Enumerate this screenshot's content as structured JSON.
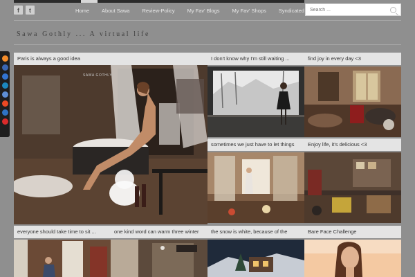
{
  "nav": {
    "items": [
      "Home",
      "About Sawa",
      "Review-Policy",
      "My Fav' Blogs",
      "My Fav' Shops",
      "Syndicated with"
    ]
  },
  "social": {
    "facebook_glyph": "f",
    "twitter_glyph": "t"
  },
  "search": {
    "placeholder": "Search ..."
  },
  "site": {
    "title": "Sawa Gothly ... A virtual life"
  },
  "sharebar": {
    "icons": [
      "blogger-icon",
      "digg-icon",
      "delicious-icon",
      "linkedin-icon",
      "reddit-icon",
      "stumbleupon-icon",
      "friendfeed-icon",
      "youtube-icon"
    ],
    "colors": [
      "#f48c2a",
      "#3a66b2",
      "#3274d1",
      "#1c87bd",
      "#5e8fd6",
      "#eb4924",
      "#2f72c4",
      "#d92b2b"
    ]
  },
  "posts": [
    {
      "title": "Paris is always a good idea",
      "photo_signature": "SAWA GOTHLY"
    },
    {
      "title": "I don't know why I'm still waiting ..."
    },
    {
      "title": "find joy in every day <3"
    },
    {
      "title": "sometimes we just have to let things"
    },
    {
      "title": "Enjoy life, it's delicious <3"
    },
    {
      "title": "everyone should take time to sit ..."
    },
    {
      "title": "one kind word can warm three winter"
    },
    {
      "title": "the snow is white, because of the"
    },
    {
      "title": "Bare Face Challenge"
    }
  ]
}
